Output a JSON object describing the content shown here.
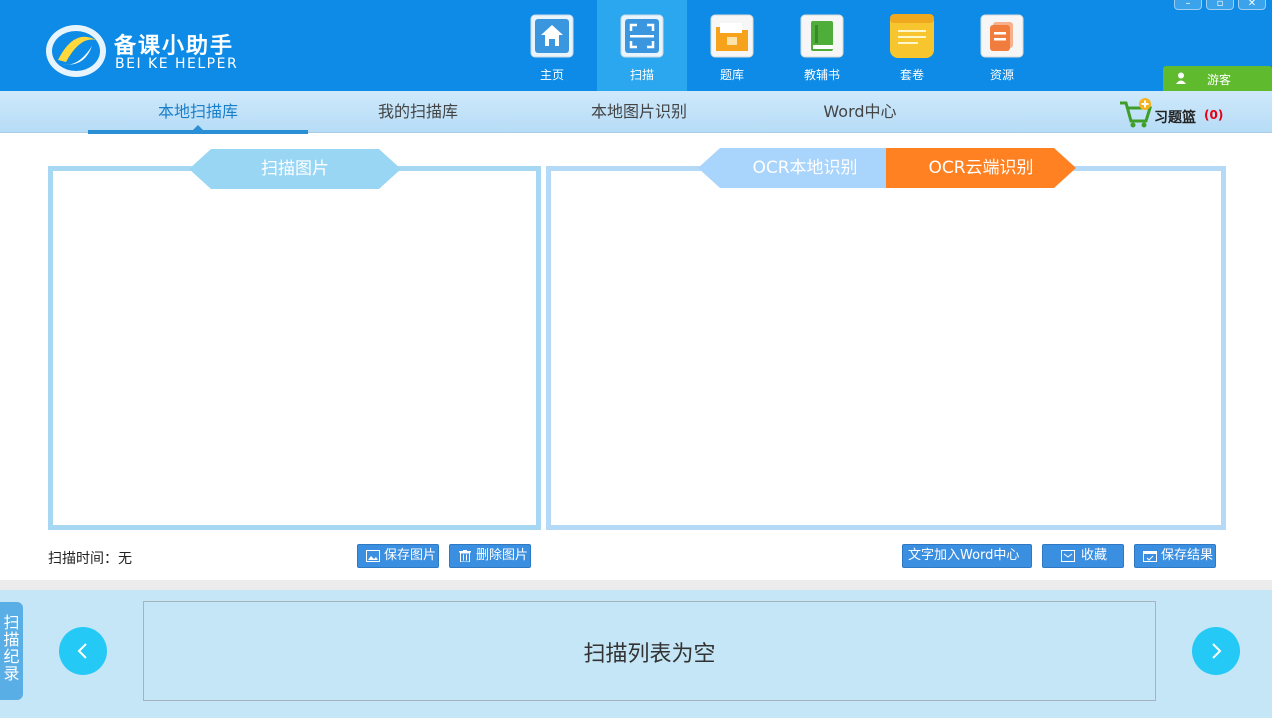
{
  "app": {
    "name_cn": "备课小助手",
    "name_en": "BEI KE HELPER"
  },
  "nav": [
    {
      "label": "主页",
      "icon": "home-icon"
    },
    {
      "label": "扫描",
      "icon": "scan-icon",
      "active": true
    },
    {
      "label": "题库",
      "icon": "question-bank-icon"
    },
    {
      "label": "教辅书",
      "icon": "book-icon"
    },
    {
      "label": "套卷",
      "icon": "notepad-icon"
    },
    {
      "label": "资源",
      "icon": "resource-icon"
    }
  ],
  "window_controls": {
    "minimize": "–",
    "maximize": "▫",
    "close": "✕"
  },
  "user": {
    "label": "游客",
    "icon": "user-icon"
  },
  "subtabs": [
    {
      "label": "本地扫描库",
      "active": true
    },
    {
      "label": "我的扫描库"
    },
    {
      "label": "本地图片识别"
    },
    {
      "label": "Word中心"
    }
  ],
  "basket": {
    "label": "习题篮",
    "count": "(0)",
    "icon": "cart-icon"
  },
  "left_panel": {
    "title": "扫描图片"
  },
  "right_panel": {
    "tab_local": "OCR本地识别",
    "tab_cloud": "OCR云端识别"
  },
  "scan_time": "扫描时间：无",
  "buttons": {
    "save_image": "保存图片",
    "delete_image": "删除图片",
    "add_to_word": "文字加入Word中心",
    "favorite": "收藏",
    "save_result": "保存结果"
  },
  "footer": {
    "side_tab": [
      "扫",
      "描",
      "纪",
      "录"
    ],
    "empty_text": "扫描列表为空"
  },
  "colors": {
    "header": "#0d8be6",
    "active_nav": "#2aa7ee",
    "ocr_cloud": "#ff8121",
    "footer": "#c5e6f6",
    "user_tab": "#5fba2d"
  }
}
